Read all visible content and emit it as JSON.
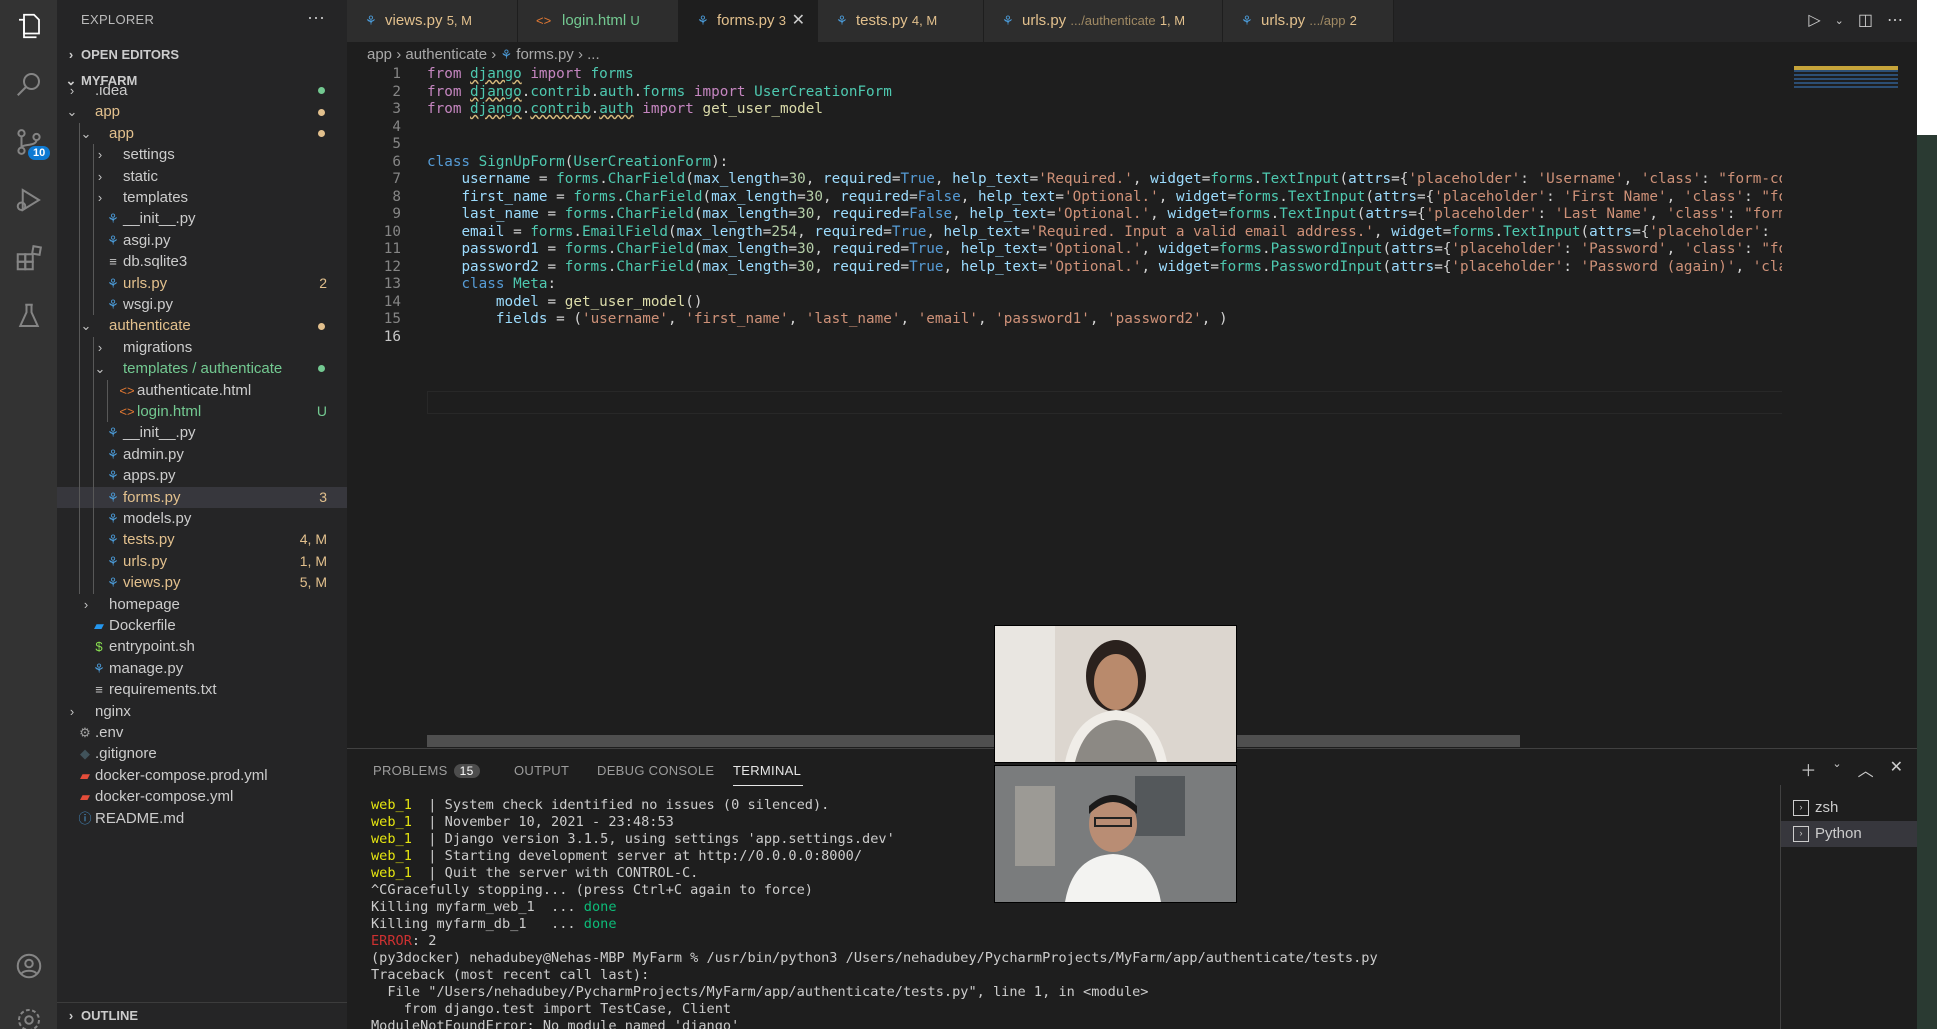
{
  "explorer": {
    "title": "EXPLORER",
    "open_editors": "OPEN EDITORS",
    "project": "MYFARM",
    "outline": "OUTLINE",
    "items": [
      {
        "label": ".idea",
        "status": ""
      },
      {
        "label": "app",
        "status": ""
      },
      {
        "label": "app",
        "status": ""
      },
      {
        "label": "settings",
        "status": ""
      },
      {
        "label": "static",
        "status": ""
      },
      {
        "label": "templates",
        "status": ""
      },
      {
        "label": "__init__.py",
        "status": ""
      },
      {
        "label": "asgi.py",
        "status": ""
      },
      {
        "label": "db.sqlite3",
        "status": ""
      },
      {
        "label": "urls.py",
        "status": "2"
      },
      {
        "label": "wsgi.py",
        "status": ""
      },
      {
        "label": "authenticate",
        "status": ""
      },
      {
        "label": "migrations",
        "status": ""
      },
      {
        "label": "templates / authenticate",
        "status": ""
      },
      {
        "label": "authenticate.html",
        "status": ""
      },
      {
        "label": "login.html",
        "status": "U"
      },
      {
        "label": "__init__.py",
        "status": ""
      },
      {
        "label": "admin.py",
        "status": ""
      },
      {
        "label": "apps.py",
        "status": ""
      },
      {
        "label": "forms.py",
        "status": "3"
      },
      {
        "label": "models.py",
        "status": ""
      },
      {
        "label": "tests.py",
        "status": "4, M"
      },
      {
        "label": "urls.py",
        "status": "1, M"
      },
      {
        "label": "views.py",
        "status": "5, M"
      },
      {
        "label": "homepage",
        "status": ""
      },
      {
        "label": "Dockerfile",
        "status": ""
      },
      {
        "label": "entrypoint.sh",
        "status": ""
      },
      {
        "label": "manage.py",
        "status": ""
      },
      {
        "label": "requirements.txt",
        "status": ""
      },
      {
        "label": "nginx",
        "status": ""
      },
      {
        "label": ".env",
        "status": ""
      },
      {
        "label": ".gitignore",
        "status": ""
      },
      {
        "label": "docker-compose.prod.yml",
        "status": ""
      },
      {
        "label": "docker-compose.yml",
        "status": ""
      },
      {
        "label": "README.md",
        "status": ""
      }
    ]
  },
  "activity": {
    "scm_badge": "10"
  },
  "tabs": [
    {
      "name": "views.py",
      "status": "5, M"
    },
    {
      "name": "login.html",
      "status": "U"
    },
    {
      "name": "forms.py",
      "status": "3"
    },
    {
      "name": "tests.py",
      "status": "4, M"
    },
    {
      "name": "urls.py",
      "path": ".../authenticate",
      "status": "1, M"
    },
    {
      "name": "urls.py",
      "path": ".../app",
      "status": "2"
    }
  ],
  "breadcrumb": {
    "a": "app",
    "b": "authenticate",
    "c": "forms.py",
    "d": "..."
  },
  "code": {
    "line_numbers": [
      "1",
      "2",
      "3",
      "4",
      "5",
      "6",
      "7",
      "8",
      "9",
      "10",
      "11",
      "12",
      "13",
      "14",
      "15",
      "16"
    ]
  },
  "panel": {
    "tabs": {
      "problems": "PROBLEMS",
      "problems_count": "15",
      "output": "OUTPUT",
      "debug": "DEBUG CONSOLE",
      "terminal": "TERMINAL"
    },
    "terminals": [
      "zsh",
      "Python"
    ]
  },
  "colors": {
    "accent": "#0e7ad3",
    "modified": "#e2c08d",
    "untracked": "#73c991",
    "window_border": "#6cbf3a"
  }
}
